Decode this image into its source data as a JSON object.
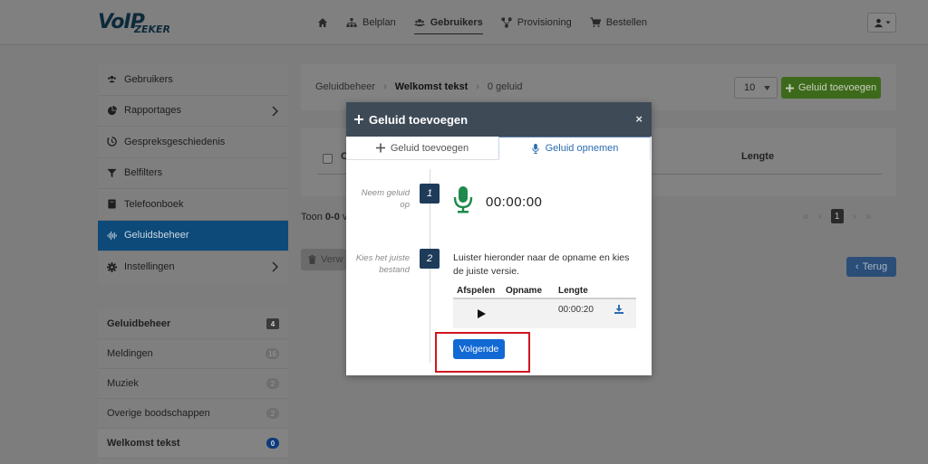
{
  "brand": {
    "logo_main": "VoIP",
    "logo_sub": "ZEKER"
  },
  "nav": {
    "items": [
      {
        "label": "",
        "icon": "home-icon"
      },
      {
        "label": "Belplan",
        "icon": "sitemap-icon"
      },
      {
        "label": "Gebruikers",
        "icon": "users-icon",
        "active": true
      },
      {
        "label": "Provisioning",
        "icon": "network-icon"
      },
      {
        "label": "Bestellen",
        "icon": "cart-icon"
      }
    ],
    "user_menu_icon": "user-icon"
  },
  "sidebar": {
    "items": [
      {
        "label": "Gebruikers",
        "icon": "users-icon"
      },
      {
        "label": "Rapportages",
        "icon": "pie-chart-icon",
        "has_submenu": true
      },
      {
        "label": "Gespreksgeschiedenis",
        "icon": "history-icon"
      },
      {
        "label": "Belfilters",
        "icon": "filter-icon"
      },
      {
        "label": "Telefoonboek",
        "icon": "phonebook-icon"
      },
      {
        "label": "Geluidsbeheer",
        "icon": "waveform-icon",
        "active": true
      },
      {
        "label": "Instellingen",
        "icon": "gear-icon",
        "has_submenu": true
      }
    ]
  },
  "sound_panel": {
    "header": {
      "label": "Geluidbeheer",
      "count": "4"
    },
    "items": [
      {
        "label": "Meldingen",
        "count": "16"
      },
      {
        "label": "Muziek",
        "count": "2"
      },
      {
        "label": "Overige boodschappen",
        "count": "2"
      },
      {
        "label": "Welkomst tekst",
        "count": "0",
        "current": true
      }
    ]
  },
  "breadcrumb": {
    "root": "Geluidbeheer",
    "current": "Welkomst tekst",
    "extra": "0 geluid"
  },
  "toolbar": {
    "page_size": "10",
    "add_label": "Geluid toevoegen"
  },
  "table": {
    "col_partial": "C",
    "col_lengte": "Lengte"
  },
  "footer": {
    "toon_prefix": "Toon ",
    "toon_bold": "0-0",
    "toon_suffix": " v",
    "page": "1",
    "delete_label": "Verw",
    "back_label": "Terug"
  },
  "modal": {
    "title": "Geluid toevoegen",
    "close": "×",
    "tabs": [
      {
        "label": "Geluid toevoegen",
        "icon": "plus-icon"
      },
      {
        "label": "Geluid opnemen",
        "icon": "microphone-icon",
        "active": true
      }
    ],
    "step1": {
      "number": "1",
      "label_line1": "Neem geluid",
      "label_line2": "op",
      "timer": "00:00:00"
    },
    "step2": {
      "number": "2",
      "label_line1": "Kies het juiste",
      "label_line2": "bestand",
      "instruction": "Luister hieronder naar de opname en kies de juiste versie.",
      "columns": [
        "Afspelen",
        "Opname",
        "Lengte"
      ],
      "row": {
        "opname": "",
        "lengte": "00:00:20"
      }
    },
    "next_label": "Volgende"
  },
  "colors": {
    "accent": "#1269d4",
    "highlight": "#d0161f",
    "mic_green": "#1e8a4c",
    "header_dark": "#3f4a57"
  }
}
